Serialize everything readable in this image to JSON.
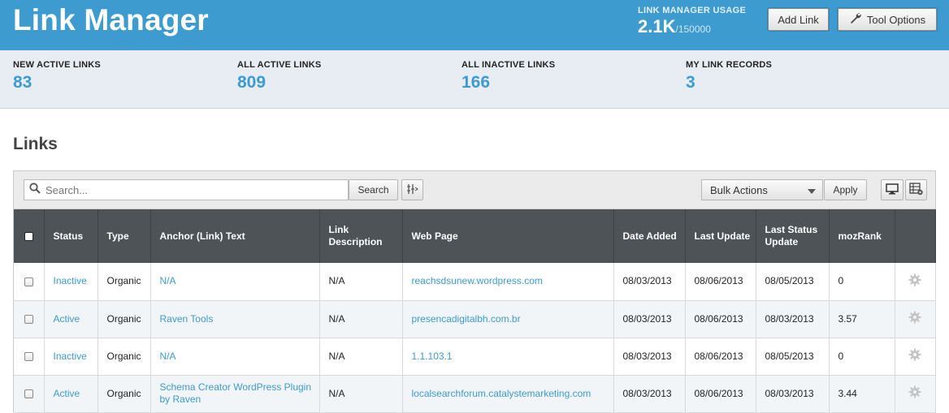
{
  "header": {
    "title": "Link Manager",
    "usage_label": "LINK MANAGER USAGE",
    "usage_value": "2.1K",
    "usage_limit": "/150000",
    "add_link_label": "Add Link",
    "tool_options_label": "Tool Options"
  },
  "stats": [
    {
      "label": "NEW ACTIVE LINKS",
      "value": "83"
    },
    {
      "label": "ALL ACTIVE LINKS",
      "value": "809"
    },
    {
      "label": "ALL INACTIVE LINKS",
      "value": "166"
    },
    {
      "label": "MY LINK RECORDS",
      "value": "3"
    }
  ],
  "section_title": "Links",
  "toolbar": {
    "search_placeholder": "Search...",
    "search_button": "Search",
    "bulk_actions": "Bulk Actions",
    "apply_button": "Apply"
  },
  "table": {
    "headers": [
      "Status",
      "Type",
      "Anchor (Link) Text",
      "Link Description",
      "Web Page",
      "Date Added",
      "Last Update",
      "Last Status Update",
      "mozRank"
    ],
    "rows": [
      {
        "status": "Inactive",
        "type": "Organic",
        "anchor": "N/A",
        "description": "N/A",
        "web_page": "reachsdsunew.wordpress.com",
        "date_added": "08/03/2013",
        "last_update": "08/06/2013",
        "last_status_update": "08/05/2013",
        "mozrank": "0"
      },
      {
        "status": "Active",
        "type": "Organic",
        "anchor": "Raven Tools",
        "description": "N/A",
        "web_page": "presencadigitalbh.com.br",
        "date_added": "08/03/2013",
        "last_update": "08/06/2013",
        "last_status_update": "08/03/2013",
        "mozrank": "3.57"
      },
      {
        "status": "Inactive",
        "type": "Organic",
        "anchor": "N/A",
        "description": "N/A",
        "web_page": "1.1.103.1",
        "date_added": "08/03/2013",
        "last_update": "08/06/2013",
        "last_status_update": "08/05/2013",
        "mozrank": "0"
      },
      {
        "status": "Active",
        "type": "Organic",
        "anchor": "Schema Creator WordPress Plugin by Raven",
        "description": "N/A",
        "web_page": "localsearchforum.catalystemarketing.com",
        "date_added": "08/03/2013",
        "last_update": "08/06/2013",
        "last_status_update": "08/03/2013",
        "mozrank": "3.44"
      }
    ]
  },
  "colors": {
    "brand": "#3d9bd0",
    "header_bg": "#3d9bd0",
    "table_header_bg": "#4e5357",
    "stats_bg": "#e7edf3"
  },
  "icons": [
    "search-icon",
    "columns-icon",
    "wrench-icon",
    "chevron-down-icon",
    "monitor-icon",
    "table-settings-icon",
    "gear-icon"
  ]
}
